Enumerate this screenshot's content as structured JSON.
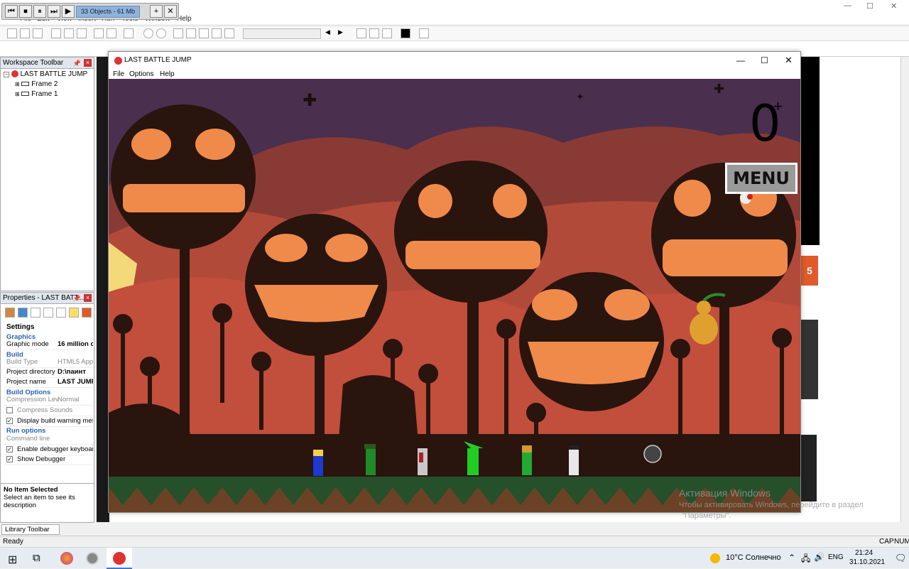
{
  "ide": {
    "menu": [
      "File",
      "Edit",
      "View",
      "Insert",
      "Run",
      "Tools",
      "Window",
      "Help"
    ],
    "window_controls": [
      "—",
      "☐",
      "✕"
    ]
  },
  "debugger": {
    "status": "33 Objects - 61 Mb",
    "buttons": [
      "⏮",
      "⏹",
      "⏸",
      "⏭",
      "▶"
    ],
    "add": "+",
    "close": "✕"
  },
  "workspace": {
    "title": "Workspace Toolbar",
    "tree": {
      "root": "LAST BATTLE JUMP",
      "children": [
        "Frame 2",
        "Frame 1"
      ]
    }
  },
  "properties": {
    "title": "Properties - LAST BATT...",
    "tab": "Settings",
    "sections": {
      "graphics": "Graphics",
      "build": "Build",
      "build_options": "Build Options",
      "run_options": "Run options"
    },
    "rows": {
      "graphic_mode": {
        "key": "Graphic mode",
        "value": "16 million c"
      },
      "build_type": {
        "key": "Build Type",
        "value": "HTML5 App"
      },
      "project_directory": {
        "key": "Project directory",
        "value": "D:\\паинт"
      },
      "project_name": {
        "key": "Project name",
        "value": "LAST JUMP"
      },
      "compression_level": {
        "key": "Compression Lev",
        "value": "Normal"
      },
      "command_line": {
        "key": "Command line",
        "value": ""
      }
    },
    "checks": {
      "compress_sounds": {
        "label": "Compress Sounds",
        "checked": false
      },
      "display_build_warning": {
        "label": "Display build warning mes",
        "checked": true
      },
      "enable_debugger_keyboard": {
        "label": "Enable debugger keyboard",
        "checked": true
      },
      "show_debugger": {
        "label": "Show Debugger",
        "checked": true
      }
    },
    "no_item_title": "No Item Selected",
    "no_item_desc": "Select an item to see its description"
  },
  "library_tab": "Library Toolbar",
  "game": {
    "window_title": "LAST BATTLE JUMP",
    "menu": [
      "File",
      "Options",
      "Help"
    ],
    "score": "0",
    "menu_button": "MENU"
  },
  "watermark": {
    "line1": "Активация Windows",
    "line2": "Чтобы активировать Windows, перейдите в раздел",
    "line3": "\"Параметры\"."
  },
  "status": {
    "left": "Ready",
    "right1": "CAP",
    "right2": "NUM"
  },
  "taskbar": {
    "weather": "10°C  Солнечно",
    "lang": "ENG",
    "time": "21:24",
    "date": "31.10.2021"
  },
  "colors": {
    "sky": "#4b2f4e",
    "cloud": "#8a3a34",
    "pumpkin_dark": "#2a140e",
    "pumpkin_glow": "#f08a4a",
    "ground": "#25502a",
    "drip": "#f3d97a"
  }
}
